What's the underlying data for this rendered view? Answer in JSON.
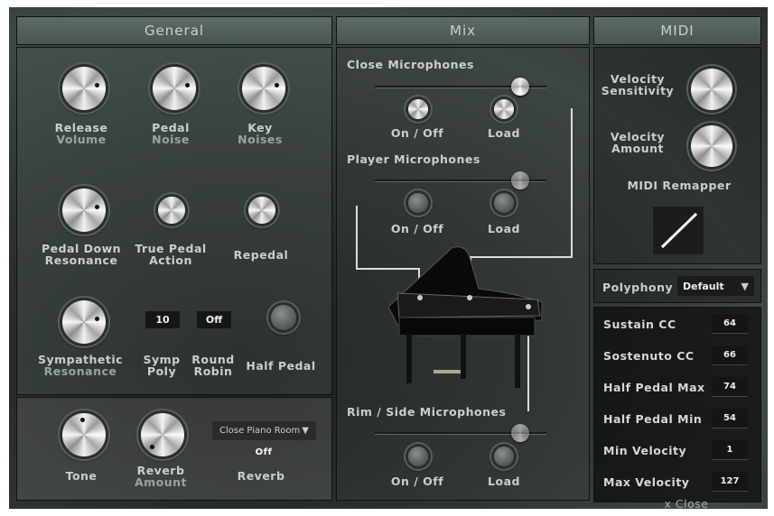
{
  "general": {
    "title": "General",
    "knobs": [
      {
        "l1": "Release",
        "l2": "Volume"
      },
      {
        "l1": "Pedal",
        "l2": "Noise"
      },
      {
        "l1": "Key",
        "l2": "Noises"
      },
      {
        "l1": "Pedal Down",
        "l2": "Resonance"
      },
      {
        "l1": "True Pedal",
        "l2": "Action"
      },
      {
        "l1": "Repedal"
      },
      {
        "l1": "Sympathetic",
        "l2": "Resonance"
      }
    ],
    "symp_poly": {
      "value": "10",
      "l1": "Symp",
      "l2": "Poly"
    },
    "round_robin": {
      "value": "Off",
      "l1": "Round",
      "l2": "Robin"
    },
    "half_pedal": "Half Pedal"
  },
  "reverb": {
    "tone": "Tone",
    "amount1": "Reverb",
    "amount2": "Amount",
    "preset": "Close Piano Room",
    "state": "Off",
    "label": "Reverb"
  },
  "mix": {
    "title": "Mix",
    "groups": [
      {
        "name": "Close Microphones",
        "on_off": "On / Off",
        "load": "Load"
      },
      {
        "name": "Player Microphones",
        "on_off": "On / Off",
        "load": "Load"
      },
      {
        "name": "Rim / Side Microphones",
        "on_off": "On / Off",
        "load": "Load"
      }
    ]
  },
  "midi": {
    "title": "MIDI",
    "vel_sens1": "Velocity",
    "vel_sens2": "Sensitivity",
    "vel_amt1": "Velocity",
    "vel_amt2": "Amount",
    "remapper": "MIDI Remapper",
    "polyphony_label": "Polyphony",
    "polyphony_value": "Default",
    "cc": [
      {
        "name": "Sustain CC",
        "value": "64"
      },
      {
        "name": "Sostenuto CC",
        "value": "66"
      },
      {
        "name": "Half Pedal Max",
        "value": "74"
      },
      {
        "name": "Half Pedal Min",
        "value": "54"
      },
      {
        "name": "Min Velocity",
        "value": "1"
      },
      {
        "name": "Max Velocity",
        "value": "127"
      }
    ],
    "close": "x Close"
  }
}
